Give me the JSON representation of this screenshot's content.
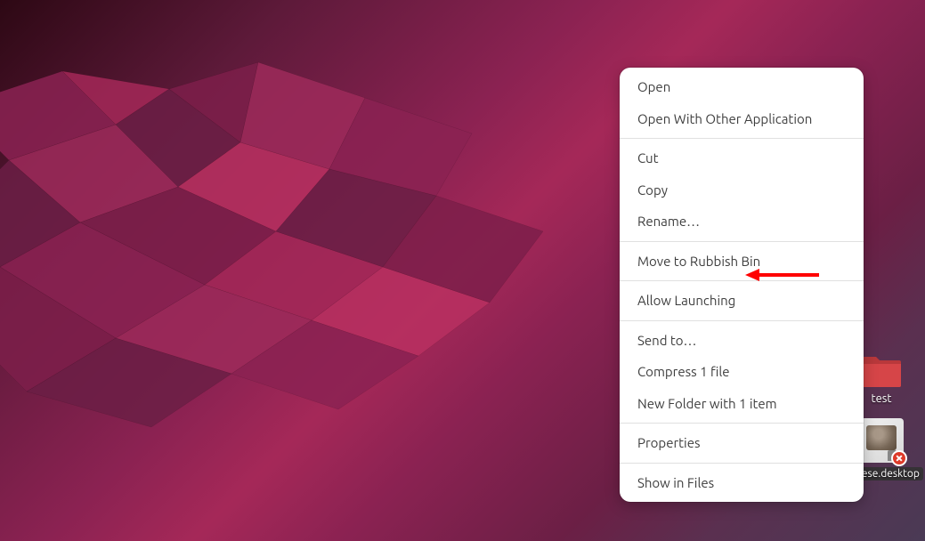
{
  "context_menu": {
    "items": [
      {
        "label": "Open",
        "id": "open"
      },
      {
        "label": "Open With Other Application",
        "id": "open-with"
      },
      {
        "label": "Cut",
        "id": "cut"
      },
      {
        "label": "Copy",
        "id": "copy"
      },
      {
        "label": "Rename…",
        "id": "rename"
      },
      {
        "label": "Move to Rubbish Bin",
        "id": "move-trash"
      },
      {
        "label": "Allow Launching",
        "id": "allow-launching"
      },
      {
        "label": "Send to…",
        "id": "send-to"
      },
      {
        "label": "Compress 1 file",
        "id": "compress"
      },
      {
        "label": "New Folder with 1 item",
        "id": "new-folder"
      },
      {
        "label": "Properties",
        "id": "properties"
      },
      {
        "label": "Show in Files",
        "id": "show-in-files"
      }
    ],
    "group_breaks": [
      2,
      5,
      6,
      7,
      10,
      11
    ]
  },
  "desktop": {
    "folder": {
      "name": "test"
    },
    "file": {
      "name": "Cheese.desktop",
      "has_error_badge": true,
      "selected": true
    }
  },
  "annotation": {
    "arrow_color": "#ff0000",
    "points_to": "allow-launching"
  }
}
